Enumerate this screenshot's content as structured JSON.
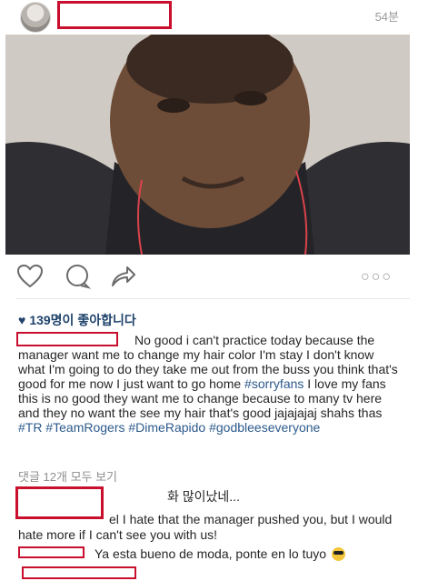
{
  "post": {
    "time": "54분",
    "likes": "139명이 좋아합니다",
    "caption_parts": [
      "No good i can't practice today because the manager want me to change my hair color I'm stay I don't know what I'm going to do they take me out from the buss you think that's good for me now I just want to go home ",
      "#sorryfans",
      " I love my fans this is no good they want me to change because to many tv here and they no want the see my hair that's good jajajajaj shahs thas ",
      "#TR",
      " ",
      "#TeamRogers",
      " ",
      "#DimeRapido",
      " ",
      "#godbleeseveryone"
    ],
    "view_comments": "댓글 12개 모두 보기"
  },
  "comments": [
    {
      "text": "화 많이났네..."
    },
    {
      "text": "el I hate that the manager pushed you, but I would hate more if I can't see you with us!"
    },
    {
      "text": "Ya esta bueno de moda, ponte en lo tuyo"
    }
  ],
  "icons": {
    "like": "heart-outline-icon",
    "comment": "speech-bubble-icon",
    "share": "share-arrow-icon",
    "more": "more-dots-icon",
    "likes_heart": "heart-filled-icon"
  },
  "colors": {
    "redaction": "#c8102e",
    "link": "#2d5a8c",
    "likes": "#20436b"
  }
}
